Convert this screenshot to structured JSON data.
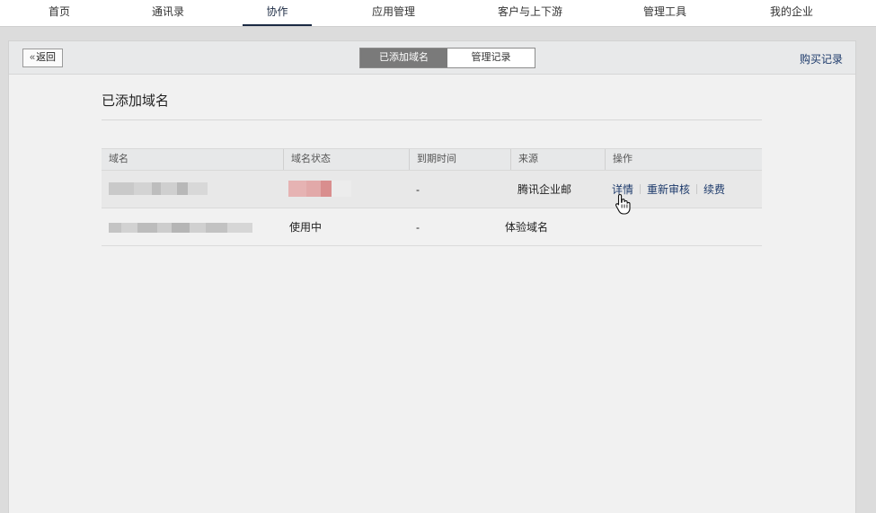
{
  "topnav": {
    "items": [
      {
        "label": "首页"
      },
      {
        "label": "通讯录"
      },
      {
        "label": "协作"
      },
      {
        "label": "应用管理"
      },
      {
        "label": "客户与上下游"
      },
      {
        "label": "管理工具"
      },
      {
        "label": "我的企业"
      }
    ],
    "active_index": 2
  },
  "header": {
    "back_label": "返回",
    "tabs": [
      {
        "label": "已添加域名",
        "active": true
      },
      {
        "label": "管理记录",
        "active": false
      }
    ],
    "buy_records_label": "购买记录"
  },
  "main": {
    "title": "已添加域名",
    "table": {
      "columns": [
        "域名",
        "域名状态",
        "到期时间",
        "来源",
        "操作"
      ],
      "rows": [
        {
          "domain": "",
          "status": "",
          "expiry": "-",
          "source": "腾讯企业邮",
          "actions": [
            "详情",
            "重新审核",
            "续费"
          ]
        },
        {
          "domain": "",
          "status": "使用中",
          "expiry": "-",
          "source": "体验域名",
          "actions": []
        }
      ]
    }
  },
  "colors": {
    "accent": "#1b2a43",
    "link": "#1d3a6b",
    "segment_active": "#7a7a7a"
  }
}
